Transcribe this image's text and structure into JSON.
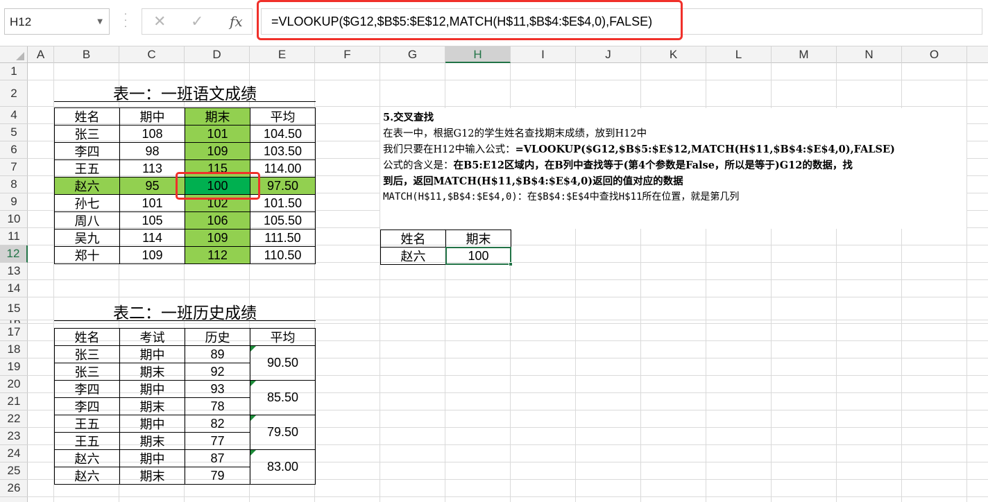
{
  "formula_bar": {
    "name_box": "H12",
    "formula": "=VLOOKUP($G12,$B$5:$E$12,MATCH(H$11,$B$4:$E$4,0),FALSE)",
    "fx_label": "fx",
    "cancel_glyph": "✕",
    "confirm_glyph": "✓"
  },
  "columns": [
    "A",
    "B",
    "C",
    "D",
    "E",
    "F",
    "G",
    "H",
    "I",
    "J",
    "K",
    "L",
    "M",
    "N",
    "O"
  ],
  "active_column": "H",
  "rows": [
    "1",
    "2",
    "4",
    "5",
    "6",
    "7",
    "8",
    "9",
    "10",
    "11",
    "12",
    "13",
    "14",
    "15",
    "16",
    "17",
    "18",
    "19",
    "20",
    "21",
    "22",
    "23",
    "24",
    "25",
    "26"
  ],
  "active_row": "12",
  "table1": {
    "title": "表一：一班语文成绩",
    "headers": [
      "姓名",
      "期中",
      "期末",
      "平均"
    ],
    "rows": [
      [
        "张三",
        "108",
        "101",
        "104.50"
      ],
      [
        "李四",
        "98",
        "109",
        "103.50"
      ],
      [
        "王五",
        "113",
        "115",
        "114.00"
      ],
      [
        "赵六",
        "95",
        "100",
        "97.50"
      ],
      [
        "孙七",
        "101",
        "102",
        "101.50"
      ],
      [
        "周八",
        "105",
        "106",
        "105.50"
      ],
      [
        "吴九",
        "114",
        "109",
        "111.50"
      ],
      [
        "郑十",
        "109",
        "112",
        "110.50"
      ]
    ]
  },
  "table2": {
    "title": "表二：一班历史成绩",
    "headers": [
      "姓名",
      "考试",
      "历史",
      "平均"
    ],
    "rows": [
      [
        "张三",
        "期中",
        "89"
      ],
      [
        "张三",
        "期末",
        "92"
      ],
      [
        "李四",
        "期中",
        "93"
      ],
      [
        "李四",
        "期末",
        "78"
      ],
      [
        "王五",
        "期中",
        "82"
      ],
      [
        "王五",
        "期末",
        "77"
      ],
      [
        "赵六",
        "期中",
        "87"
      ],
      [
        "赵六",
        "期末",
        "79"
      ]
    ],
    "averages": [
      "90.50",
      "85.50",
      "79.50",
      "83.00"
    ]
  },
  "description": {
    "heading": "5.交叉查找",
    "line1": "在表一中，根据G12的学生姓名查找期末成绩，放到H12中",
    "line2_prefix": "我们只要在H12中输入公式：",
    "line2_formula": "=VLOOKUP($G12,$B$5:$E$12,MATCH(H$11,$B$4:$E$4,0),FALSE)",
    "line3_prefix": "公式的含义是：",
    "line3_rest": "在B5:E12区域内，在B列中查找等于(第4个参数是False，所以是等于)G12的数据，找",
    "line4": "到后，返回MATCH(H$11,$B$4:$E$4,0)返回的值对应的数据",
    "line5": "MATCH(H$11,$B$4:$E$4,0)：在$B$4:$E$4中查找H$11所在位置，就是第几列"
  },
  "lookup": {
    "headers": [
      "姓名",
      "期末"
    ],
    "name": "赵六",
    "result": "100"
  }
}
